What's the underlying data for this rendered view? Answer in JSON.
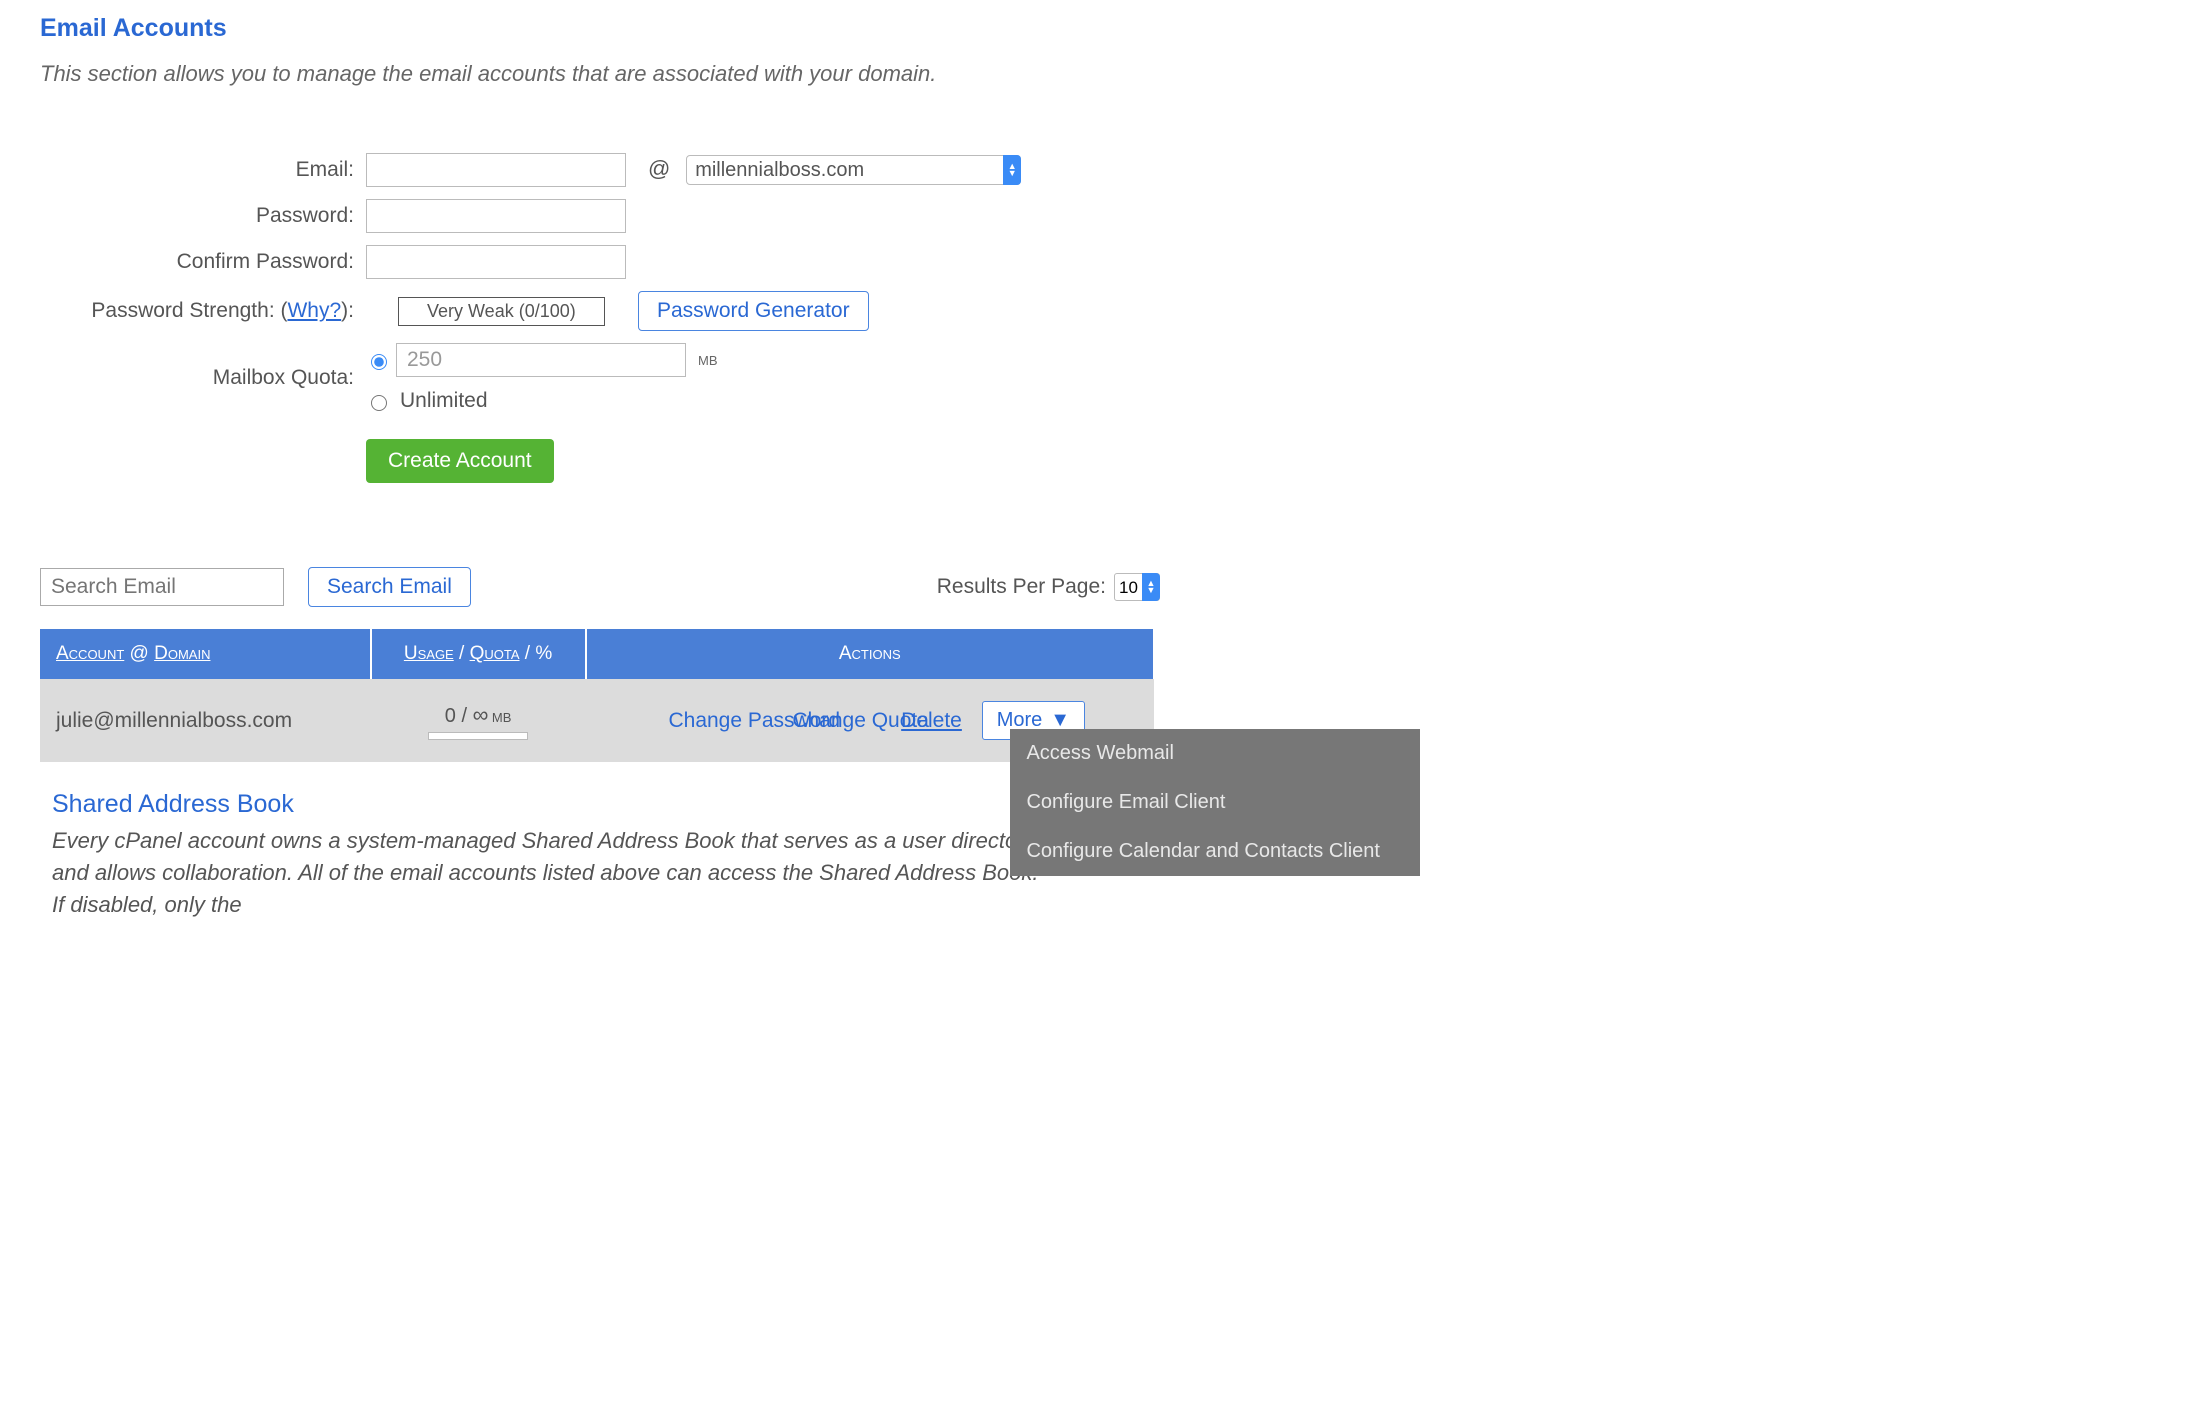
{
  "page_title": "Email Accounts",
  "intro": "This section allows you to manage the email accounts that are associated with your domain.",
  "form": {
    "email_label": "Email:",
    "email_value": "",
    "at": "@",
    "domain_selected": "millennialboss.com",
    "password_label": "Password:",
    "password_value": "",
    "confirm_label": "Confirm Password:",
    "confirm_value": "",
    "strength_label_prefix": "Password Strength: (",
    "strength_why": "Why?",
    "strength_label_suffix": "):",
    "strength_text": "Very Weak (0/100)",
    "generator_btn": "Password Generator",
    "quota_label": "Mailbox Quota:",
    "quota_value": "250",
    "quota_unit": "MB",
    "unlimited_label": "Unlimited",
    "create_btn": "Create Account"
  },
  "search": {
    "placeholder": "Search Email",
    "button": "Search Email",
    "results_label": "Results Per Page:",
    "results_value": "10"
  },
  "table": {
    "col_account_a": "Account",
    "col_account_at": " @ ",
    "col_account_b": "Domain",
    "col_usage_a": "Usage",
    "col_usage_sep": " / ",
    "col_usage_b": "Quota",
    "col_usage_sep2": " / ",
    "col_usage_c": "%",
    "col_actions": "Actions",
    "row": {
      "account": "julie@millennialboss.com",
      "usage_zero": "0",
      "usage_slash": " / ",
      "usage_inf": "∞",
      "usage_mb": " MB",
      "change_password": "Change Password",
      "change_quota": "Change Quota",
      "delete": "Delete",
      "more": "More"
    }
  },
  "more_menu": {
    "items": [
      "Access Webmail",
      "Configure Email Client",
      "Configure Calendar and Contacts Client"
    ]
  },
  "sab_title": "Shared Address Book",
  "sab_text": "Every cPanel account owns a system-managed Shared Address Book that serves as a user directory and allows collaboration. All of the email accounts listed above can access the Shared Address Book. If disabled, only the"
}
